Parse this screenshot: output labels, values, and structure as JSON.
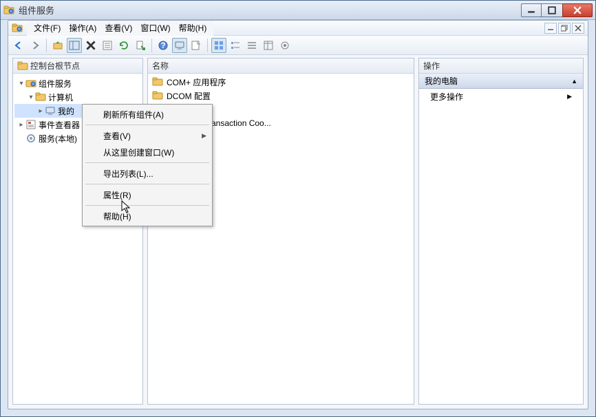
{
  "window": {
    "title": "组件服务"
  },
  "menubar": {
    "file": "文件(F)",
    "action": "操作(A)",
    "view": "查看(V)",
    "window": "窗口(W)",
    "help": "帮助(H)"
  },
  "left_pane": {
    "header": "控制台根节点",
    "tree": {
      "root": "组件服务",
      "computers": "计算机",
      "mycomputer": "我的",
      "eventviewer": "事件查看器",
      "services": "服务(本地)"
    }
  },
  "mid_pane": {
    "header": "名称",
    "items": [
      "COM+ 应用程序",
      "DCOM 配置",
      "ansaction Coo..."
    ]
  },
  "right_pane": {
    "header": "操作",
    "context": "我的电脑",
    "more": "更多操作"
  },
  "context_menu": {
    "refresh_all": "刷新所有组件(A)",
    "view": "查看(V)",
    "new_window": "从这里创建窗口(W)",
    "export_list": "导出列表(L)...",
    "properties": "属性(R)",
    "help": "帮助(H)"
  }
}
